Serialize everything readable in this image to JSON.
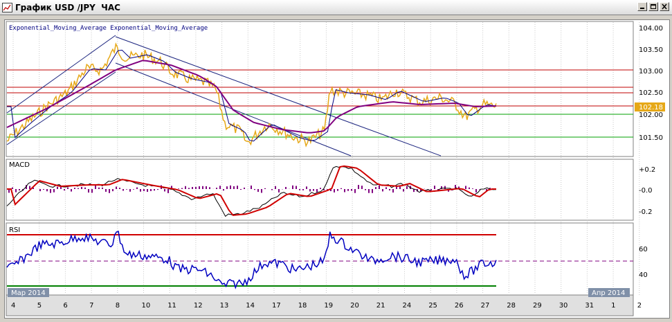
{
  "window": {
    "title": "График USD /JPY  ЧАС",
    "minimize_icon": "minimize-icon",
    "restore_icon": "restore-icon",
    "close_icon": "close-icon"
  },
  "price_panel": {
    "indicator_label": "Exponential_Moving_Average Exponential_Moving_Average",
    "y_ticks": [
      "104.00",
      "103.50",
      "103.00",
      "102.50",
      "102.00",
      "101.50"
    ],
    "current_price": "102.18",
    "colors": {
      "price": "#e6a817",
      "ema_fast": "#000080",
      "ema_slow": "#800080",
      "hline_red": "#c00000",
      "hline_green": "#00a000",
      "channel": "#1a237e",
      "current_price_bg": "#e6a817"
    }
  },
  "macd_panel": {
    "label": "MACD",
    "y_ticks": [
      "+0.2",
      "-0.0",
      "-0.2"
    ],
    "colors": {
      "macd": "#000000",
      "signal": "#d00000",
      "histogram": "#800080"
    }
  },
  "rsi_panel": {
    "label": "RSI",
    "y_ticks": [
      "60",
      "40"
    ],
    "colors": {
      "rsi": "#0000c0",
      "upper": "#d00000",
      "lower": "#008000",
      "mid": "#800080"
    }
  },
  "time_axis": {
    "labels": [
      "4",
      "5",
      "6",
      "7",
      "8",
      "10",
      "11",
      "12",
      "13",
      "14",
      "17",
      "18",
      "19",
      "20",
      "21",
      "24",
      "25",
      "26",
      "27",
      "28",
      "29",
      "30",
      "31",
      "1",
      "2"
    ],
    "month_start_label": "Мар 2014",
    "month_end_label": "Апр 2014"
  }
}
